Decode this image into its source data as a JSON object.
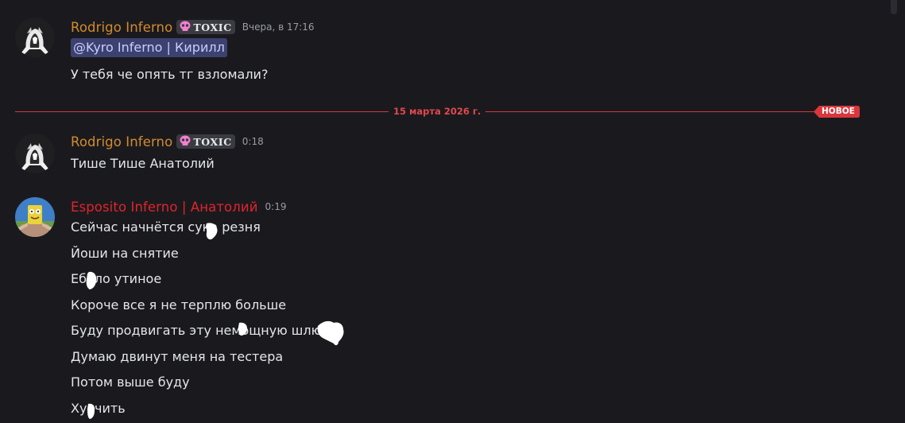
{
  "messages": [
    {
      "username": "Rodrigo Inferno",
      "tag": "TOXIC",
      "timestamp": "Вчера, в 17:16",
      "mention": "@Kyro Inferno | Кирилл",
      "lines": [
        "У тебя че опять тг взломали?"
      ]
    },
    {
      "username": "Rodrigo Inferno",
      "tag": "TOXIC",
      "timestamp": "0:18",
      "lines": [
        "Тише Тише Анатолий"
      ]
    },
    {
      "username": "Esposito Inferno | Анатолий",
      "timestamp": "0:19",
      "lines": [
        "Сейчас начнётся сука резня",
        "Йоши на снятие",
        "Ебало утиное",
        "Короче все я не терплю больше",
        "Буду продвигать эту немощную шлюху",
        "Думаю двинут меня на тестера",
        "Потом выше буду",
        "Хуячить"
      ]
    }
  ],
  "divider": {
    "date": "15 марта 2026 г.",
    "new_label": "НОВОЕ"
  },
  "colors": {
    "background": "#1a1a1e",
    "username_orange": "#d28b2e",
    "username_red": "#e0242b",
    "mention_bg": "#3c4170",
    "divider_red": "#d8363b",
    "tag_skull": "#f47fd0"
  },
  "icons": {
    "tag_icon": "skull-icon",
    "avatar_1": "hooded-figure-avatar",
    "avatar_2": "sponge-character-avatar"
  }
}
